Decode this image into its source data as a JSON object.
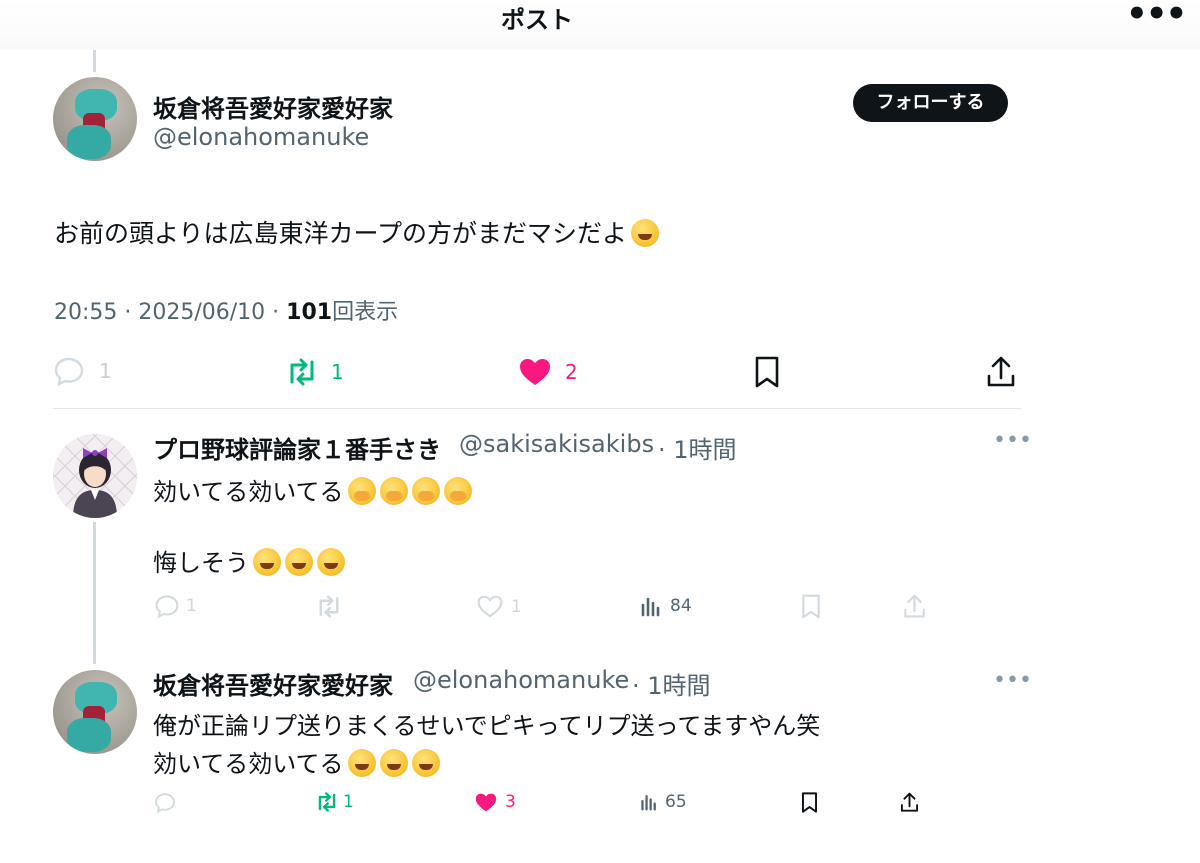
{
  "header": {
    "title": "ポスト",
    "more_label": "•••"
  },
  "main_post": {
    "name": "坂倉将吾愛好家愛好家",
    "handle": "@elonahomanuke",
    "follow_label": "フォローする",
    "text": "お前の頭よりは広島東洋カープの方がまだマシだよ",
    "time": "20:55 · 2025/06/10 · ",
    "views_count": "101",
    "views_label": "回表示",
    "actions": {
      "reply": "1",
      "repost": "1",
      "like": "2"
    },
    "emoji": [
      "rolling-on-floor-laughing"
    ]
  },
  "replies": [
    {
      "name": "プロ野球評論家１番手さき",
      "handle": "@sakisakisakibs",
      "time": "· 1時間",
      "line1": "効いてる効いてる",
      "line2": "悔しそう",
      "actions": {
        "reply": "1",
        "repost": "",
        "like": "1",
        "views": "84"
      }
    },
    {
      "name": "坂倉将吾愛好家愛好家",
      "handle": "@elonahomanuke",
      "time": "· 1時間",
      "line1": "俺が正論リプ送りまくるせいでピキってリプ送ってますやん笑",
      "line2": "効いてる効いてる",
      "actions": {
        "reply": "",
        "repost": "1",
        "like": "3",
        "views": "65"
      }
    }
  ],
  "colors": {
    "accent_green": "#00ba7c",
    "accent_pink": "#f91880",
    "muted": "#536471"
  }
}
